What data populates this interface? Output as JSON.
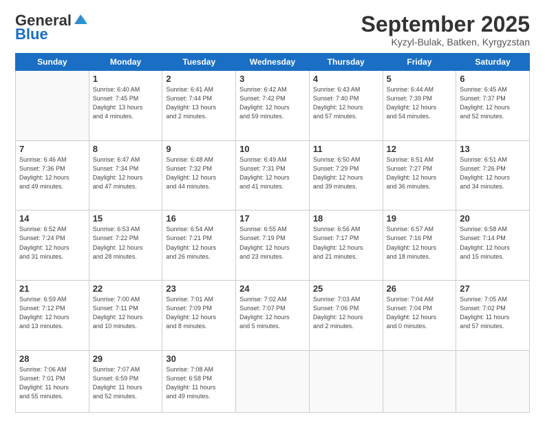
{
  "logo": {
    "general": "General",
    "blue": "Blue"
  },
  "title": "September 2025",
  "location": "Kyzyl-Bulak, Batken, Kyrgyzstan",
  "days_of_week": [
    "Sunday",
    "Monday",
    "Tuesday",
    "Wednesday",
    "Thursday",
    "Friday",
    "Saturday"
  ],
  "weeks": [
    [
      {
        "day": "",
        "info": ""
      },
      {
        "day": "1",
        "info": "Sunrise: 6:40 AM\nSunset: 7:45 PM\nDaylight: 13 hours\nand 4 minutes."
      },
      {
        "day": "2",
        "info": "Sunrise: 6:41 AM\nSunset: 7:44 PM\nDaylight: 13 hours\nand 2 minutes."
      },
      {
        "day": "3",
        "info": "Sunrise: 6:42 AM\nSunset: 7:42 PM\nDaylight: 12 hours\nand 59 minutes."
      },
      {
        "day": "4",
        "info": "Sunrise: 6:43 AM\nSunset: 7:40 PM\nDaylight: 12 hours\nand 57 minutes."
      },
      {
        "day": "5",
        "info": "Sunrise: 6:44 AM\nSunset: 7:39 PM\nDaylight: 12 hours\nand 54 minutes."
      },
      {
        "day": "6",
        "info": "Sunrise: 6:45 AM\nSunset: 7:37 PM\nDaylight: 12 hours\nand 52 minutes."
      }
    ],
    [
      {
        "day": "7",
        "info": "Sunrise: 6:46 AM\nSunset: 7:36 PM\nDaylight: 12 hours\nand 49 minutes."
      },
      {
        "day": "8",
        "info": "Sunrise: 6:47 AM\nSunset: 7:34 PM\nDaylight: 12 hours\nand 47 minutes."
      },
      {
        "day": "9",
        "info": "Sunrise: 6:48 AM\nSunset: 7:32 PM\nDaylight: 12 hours\nand 44 minutes."
      },
      {
        "day": "10",
        "info": "Sunrise: 6:49 AM\nSunset: 7:31 PM\nDaylight: 12 hours\nand 41 minutes."
      },
      {
        "day": "11",
        "info": "Sunrise: 6:50 AM\nSunset: 7:29 PM\nDaylight: 12 hours\nand 39 minutes."
      },
      {
        "day": "12",
        "info": "Sunrise: 6:51 AM\nSunset: 7:27 PM\nDaylight: 12 hours\nand 36 minutes."
      },
      {
        "day": "13",
        "info": "Sunrise: 6:51 AM\nSunset: 7:26 PM\nDaylight: 12 hours\nand 34 minutes."
      }
    ],
    [
      {
        "day": "14",
        "info": "Sunrise: 6:52 AM\nSunset: 7:24 PM\nDaylight: 12 hours\nand 31 minutes."
      },
      {
        "day": "15",
        "info": "Sunrise: 6:53 AM\nSunset: 7:22 PM\nDaylight: 12 hours\nand 28 minutes."
      },
      {
        "day": "16",
        "info": "Sunrise: 6:54 AM\nSunset: 7:21 PM\nDaylight: 12 hours\nand 26 minutes."
      },
      {
        "day": "17",
        "info": "Sunrise: 6:55 AM\nSunset: 7:19 PM\nDaylight: 12 hours\nand 23 minutes."
      },
      {
        "day": "18",
        "info": "Sunrise: 6:56 AM\nSunset: 7:17 PM\nDaylight: 12 hours\nand 21 minutes."
      },
      {
        "day": "19",
        "info": "Sunrise: 6:57 AM\nSunset: 7:16 PM\nDaylight: 12 hours\nand 18 minutes."
      },
      {
        "day": "20",
        "info": "Sunrise: 6:58 AM\nSunset: 7:14 PM\nDaylight: 12 hours\nand 15 minutes."
      }
    ],
    [
      {
        "day": "21",
        "info": "Sunrise: 6:59 AM\nSunset: 7:12 PM\nDaylight: 12 hours\nand 13 minutes."
      },
      {
        "day": "22",
        "info": "Sunrise: 7:00 AM\nSunset: 7:11 PM\nDaylight: 12 hours\nand 10 minutes."
      },
      {
        "day": "23",
        "info": "Sunrise: 7:01 AM\nSunset: 7:09 PM\nDaylight: 12 hours\nand 8 minutes."
      },
      {
        "day": "24",
        "info": "Sunrise: 7:02 AM\nSunset: 7:07 PM\nDaylight: 12 hours\nand 5 minutes."
      },
      {
        "day": "25",
        "info": "Sunrise: 7:03 AM\nSunset: 7:06 PM\nDaylight: 12 hours\nand 2 minutes."
      },
      {
        "day": "26",
        "info": "Sunrise: 7:04 AM\nSunset: 7:04 PM\nDaylight: 12 hours\nand 0 minutes."
      },
      {
        "day": "27",
        "info": "Sunrise: 7:05 AM\nSunset: 7:02 PM\nDaylight: 11 hours\nand 57 minutes."
      }
    ],
    [
      {
        "day": "28",
        "info": "Sunrise: 7:06 AM\nSunset: 7:01 PM\nDaylight: 11 hours\nand 55 minutes."
      },
      {
        "day": "29",
        "info": "Sunrise: 7:07 AM\nSunset: 6:59 PM\nDaylight: 11 hours\nand 52 minutes."
      },
      {
        "day": "30",
        "info": "Sunrise: 7:08 AM\nSunset: 6:58 PM\nDaylight: 11 hours\nand 49 minutes."
      },
      {
        "day": "",
        "info": ""
      },
      {
        "day": "",
        "info": ""
      },
      {
        "day": "",
        "info": ""
      },
      {
        "day": "",
        "info": ""
      }
    ]
  ]
}
